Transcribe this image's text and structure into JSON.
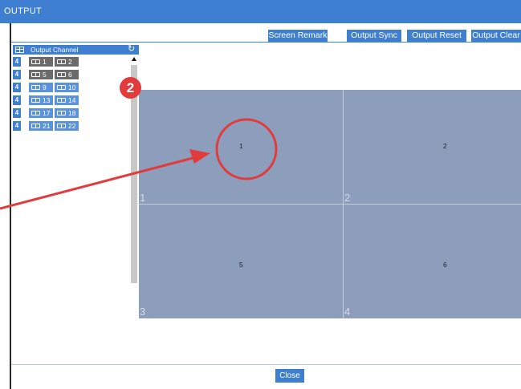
{
  "window": {
    "title": "OUTPUT"
  },
  "toolbar": {
    "screen_remark": "Screen Remark",
    "output_sync": "Output Sync",
    "output_reset": "Output Reset",
    "output_clear": "Output Clear"
  },
  "panel": {
    "header": "Output Channel",
    "icons": {
      "header": "grid-icon",
      "refresh": "refresh-icon"
    },
    "rows": [
      {
        "badge": "4",
        "items": [
          {
            "label": "1",
            "state": "dark"
          },
          {
            "label": "2",
            "state": "dark"
          }
        ]
      },
      {
        "badge": "4",
        "items": [
          {
            "label": "5",
            "state": "dark"
          },
          {
            "label": "6",
            "state": "dark"
          }
        ]
      },
      {
        "badge": "4",
        "items": [
          {
            "label": "9",
            "state": "blue"
          },
          {
            "label": "10",
            "state": "blue"
          }
        ]
      },
      {
        "badge": "4",
        "items": [
          {
            "label": "13",
            "state": "blue"
          },
          {
            "label": "14",
            "state": "blue"
          }
        ]
      },
      {
        "badge": "4",
        "items": [
          {
            "label": "17",
            "state": "blue"
          },
          {
            "label": "18",
            "state": "blue"
          }
        ]
      },
      {
        "badge": "4",
        "items": [
          {
            "label": "21",
            "state": "blue"
          },
          {
            "label": "22",
            "state": "blue"
          }
        ]
      }
    ]
  },
  "annotation": {
    "marker_number": "2",
    "color": "#e23b3b"
  },
  "wall": {
    "cells": [
      {
        "center_label": "1",
        "corner_label": "1"
      },
      {
        "center_label": "2",
        "corner_label": "2"
      },
      {
        "center_label": "5",
        "corner_label": "3"
      },
      {
        "center_label": "6",
        "corner_label": "4"
      }
    ]
  },
  "footer": {
    "close_label": "Close"
  },
  "colors": {
    "accent": "#3f7fd2",
    "wall": "#8d9dbc",
    "channel_active": "#6b6b6b",
    "channel_idle": "#5a93db"
  }
}
